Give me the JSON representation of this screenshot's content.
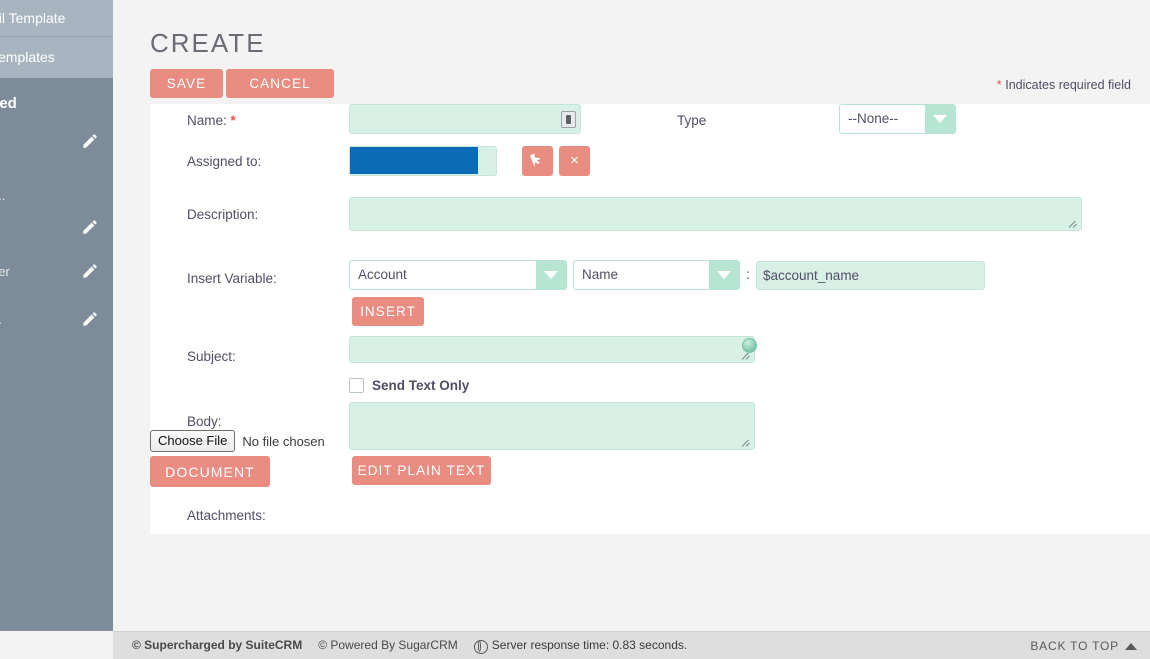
{
  "sidebar": {
    "menu_items": [
      {
        "label": "ail Template"
      },
      {
        "label": "Templates"
      }
    ],
    "section_title": "ved",
    "rows": [
      {
        "label": "",
        "icon": "pencil-icon"
      },
      {
        "label": "....",
        "icon": ""
      },
      {
        "label": "-",
        "icon": "pencil-icon"
      },
      {
        "label": "der",
        "icon": "pencil-icon"
      },
      {
        "label": "...",
        "icon": "pencil-icon"
      }
    ],
    "collapse_icon": "chevron-left-icon"
  },
  "header": {
    "title": "CREATE",
    "save_label": "SAVE",
    "cancel_label": "CANCEL",
    "required_star": "*",
    "required_note": "Indicates required field"
  },
  "form": {
    "name": {
      "label": "Name:",
      "required_star": "*",
      "value": "",
      "badge_icon": "card-badge-icon"
    },
    "type": {
      "label": "Type",
      "selected": "--None--"
    },
    "assigned_to": {
      "label": "Assigned to:",
      "value": "",
      "select_button_icon": "cursor-arrow-icon",
      "clear_button_icon": "close-icon",
      "clear_button_label": "×"
    },
    "description": {
      "label": "Description:",
      "value": ""
    },
    "insert_variable": {
      "label": "Insert Variable:",
      "module_selected": "Account",
      "field_selected": "Name",
      "separator": ":",
      "variable_value": "$account_name",
      "insert_label": "INSERT"
    },
    "subject": {
      "label": "Subject:",
      "value": ""
    },
    "send_text_only": {
      "label": "Send Text Only",
      "checked": false
    },
    "body": {
      "label": "Body:",
      "value": "",
      "edit_plain_text_label": "EDIT PLAIN TEXT"
    },
    "attachments": {
      "label": "Attachments:",
      "choose_file_label": "Choose File",
      "no_file_text": "No file chosen",
      "document_label": "DOCUMENT"
    }
  },
  "footer": {
    "supercharged": "© Supercharged by SuiteCRM",
    "powered": "© Powered By SugarCRM",
    "server_time": "Server response time: 0.83 seconds.",
    "back_to_top": "BACK TO TOP"
  },
  "colors": {
    "accent": "#e98c82",
    "field_bg": "#d9f0e7",
    "sidebar_bg": "#7e8c99",
    "sidebar_item_bg": "#a8b5c0",
    "selection_blue": "#0b6cb5",
    "required_red": "#e5554f"
  }
}
